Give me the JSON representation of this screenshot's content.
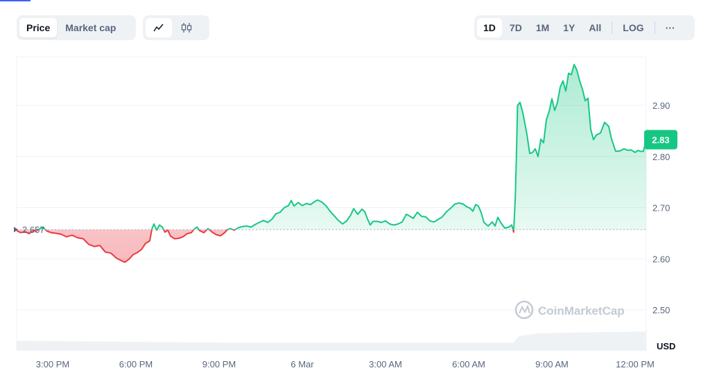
{
  "toggle": {
    "price_label": "Price",
    "market_cap_label": "Market cap"
  },
  "chart_type_icons": [
    "line-chart-icon",
    "candlestick-icon"
  ],
  "ranges": [
    "1D",
    "7D",
    "1M",
    "1Y",
    "All"
  ],
  "log_label": "LOG",
  "more_label": "···",
  "watermark": "CoinMarketCap",
  "colors": {
    "up": "#16c784",
    "down": "#ea3943",
    "grid": "#eff2f5",
    "axis_text": "#58667e"
  },
  "chart_data": {
    "type": "area",
    "baseline": 2.657,
    "baseline_label": "2.657",
    "current_value_label": "2.83",
    "current_value": 2.833,
    "y_unit": "USD",
    "y_ticks": [
      2.5,
      2.6,
      2.7,
      2.8,
      2.9
    ],
    "y_tick_labels": [
      "2.50",
      "2.60",
      "2.70",
      "2.80",
      "2.90"
    ],
    "ylim": [
      2.42,
      2.995
    ],
    "x_tick_labels": [
      "3:00 PM",
      "6:00 PM",
      "9:00 PM",
      "6 Mar",
      "3:00 AM",
      "6:00 AM",
      "9:00 AM",
      "12:00 PM"
    ],
    "x_tick_hours": [
      0,
      3,
      6,
      9,
      12,
      15,
      18,
      21
    ],
    "xlim_hours": [
      -1.3,
      21.4
    ],
    "series": [
      {
        "values": [
          [
            -1.3,
            2.655
          ],
          [
            -1.15,
            2.651
          ],
          [
            -1.0,
            2.653
          ],
          [
            -0.85,
            2.649
          ],
          [
            -0.7,
            2.655
          ],
          [
            -0.6,
            2.654
          ],
          [
            -0.5,
            2.658
          ],
          [
            -0.35,
            2.661
          ],
          [
            -0.2,
            2.654
          ],
          [
            -0.05,
            2.651
          ],
          [
            0.1,
            2.65
          ],
          [
            0.3,
            2.648
          ],
          [
            0.5,
            2.643
          ],
          [
            0.7,
            2.646
          ],
          [
            0.9,
            2.641
          ],
          [
            1.1,
            2.639
          ],
          [
            1.3,
            2.628
          ],
          [
            1.5,
            2.624
          ],
          [
            1.7,
            2.626
          ],
          [
            1.9,
            2.613
          ],
          [
            2.1,
            2.611
          ],
          [
            2.3,
            2.601
          ],
          [
            2.45,
            2.597
          ],
          [
            2.6,
            2.593
          ],
          [
            2.75,
            2.599
          ],
          [
            2.9,
            2.608
          ],
          [
            3.05,
            2.612
          ],
          [
            3.2,
            2.618
          ],
          [
            3.35,
            2.63
          ],
          [
            3.5,
            2.635
          ],
          [
            3.58,
            2.659
          ],
          [
            3.65,
            2.668
          ],
          [
            3.75,
            2.656
          ],
          [
            3.85,
            2.666
          ],
          [
            3.95,
            2.662
          ],
          [
            4.05,
            2.652
          ],
          [
            4.15,
            2.656
          ],
          [
            4.25,
            2.644
          ],
          [
            4.4,
            2.639
          ],
          [
            4.55,
            2.64
          ],
          [
            4.7,
            2.643
          ],
          [
            4.85,
            2.649
          ],
          [
            5.0,
            2.651
          ],
          [
            5.1,
            2.658
          ],
          [
            5.2,
            2.662
          ],
          [
            5.3,
            2.655
          ],
          [
            5.45,
            2.651
          ],
          [
            5.6,
            2.659
          ],
          [
            5.75,
            2.652
          ],
          [
            5.9,
            2.647
          ],
          [
            6.05,
            2.645
          ],
          [
            6.2,
            2.651
          ],
          [
            6.3,
            2.657
          ],
          [
            6.4,
            2.659
          ],
          [
            6.55,
            2.656
          ],
          [
            6.7,
            2.661
          ],
          [
            6.85,
            2.663
          ],
          [
            7.0,
            2.664
          ],
          [
            7.15,
            2.662
          ],
          [
            7.3,
            2.667
          ],
          [
            7.45,
            2.671
          ],
          [
            7.6,
            2.675
          ],
          [
            7.75,
            2.671
          ],
          [
            7.9,
            2.677
          ],
          [
            8.05,
            2.688
          ],
          [
            8.2,
            2.691
          ],
          [
            8.35,
            2.7
          ],
          [
            8.5,
            2.704
          ],
          [
            8.6,
            2.714
          ],
          [
            8.7,
            2.703
          ],
          [
            8.85,
            2.71
          ],
          [
            9.0,
            2.704
          ],
          [
            9.15,
            2.708
          ],
          [
            9.3,
            2.706
          ],
          [
            9.45,
            2.712
          ],
          [
            9.55,
            2.715
          ],
          [
            9.7,
            2.711
          ],
          [
            9.85,
            2.704
          ],
          [
            10.0,
            2.693
          ],
          [
            10.15,
            2.684
          ],
          [
            10.3,
            2.675
          ],
          [
            10.45,
            2.668
          ],
          [
            10.6,
            2.674
          ],
          [
            10.75,
            2.686
          ],
          [
            10.85,
            2.698
          ],
          [
            11.0,
            2.687
          ],
          [
            11.15,
            2.697
          ],
          [
            11.25,
            2.692
          ],
          [
            11.35,
            2.678
          ],
          [
            11.45,
            2.666
          ],
          [
            11.55,
            2.673
          ],
          [
            11.7,
            2.673
          ],
          [
            11.85,
            2.671
          ],
          [
            12.0,
            2.674
          ],
          [
            12.15,
            2.668
          ],
          [
            12.3,
            2.666
          ],
          [
            12.45,
            2.668
          ],
          [
            12.6,
            2.672
          ],
          [
            12.75,
            2.687
          ],
          [
            12.85,
            2.684
          ],
          [
            13.0,
            2.679
          ],
          [
            13.15,
            2.691
          ],
          [
            13.3,
            2.683
          ],
          [
            13.45,
            2.682
          ],
          [
            13.6,
            2.674
          ],
          [
            13.75,
            2.672
          ],
          [
            13.9,
            2.677
          ],
          [
            14.05,
            2.682
          ],
          [
            14.2,
            2.692
          ],
          [
            14.35,
            2.699
          ],
          [
            14.5,
            2.707
          ],
          [
            14.65,
            2.709
          ],
          [
            14.8,
            2.707
          ],
          [
            14.95,
            2.701
          ],
          [
            15.05,
            2.699
          ],
          [
            15.15,
            2.693
          ],
          [
            15.25,
            2.706
          ],
          [
            15.35,
            2.703
          ],
          [
            15.45,
            2.69
          ],
          [
            15.55,
            2.671
          ],
          [
            15.7,
            2.664
          ],
          [
            15.85,
            2.672
          ],
          [
            15.95,
            2.664
          ],
          [
            16.05,
            2.681
          ],
          [
            16.15,
            2.671
          ],
          [
            16.3,
            2.66
          ],
          [
            16.45,
            2.662
          ],
          [
            16.55,
            2.666
          ],
          [
            16.62,
            2.652
          ],
          [
            16.68,
            2.72
          ],
          [
            16.72,
            2.8
          ],
          [
            16.76,
            2.9
          ],
          [
            16.85,
            2.906
          ],
          [
            16.95,
            2.886
          ],
          [
            17.1,
            2.843
          ],
          [
            17.2,
            2.806
          ],
          [
            17.3,
            2.808
          ],
          [
            17.4,
            2.815
          ],
          [
            17.5,
            2.8
          ],
          [
            17.6,
            2.834
          ],
          [
            17.7,
            2.827
          ],
          [
            17.8,
            2.872
          ],
          [
            17.9,
            2.888
          ],
          [
            18.0,
            2.913
          ],
          [
            18.1,
            2.89
          ],
          [
            18.2,
            2.906
          ],
          [
            18.3,
            2.936
          ],
          [
            18.4,
            2.948
          ],
          [
            18.5,
            2.928
          ],
          [
            18.6,
            2.963
          ],
          [
            18.7,
            2.96
          ],
          [
            18.8,
            2.98
          ],
          [
            18.9,
            2.969
          ],
          [
            19.0,
            2.948
          ],
          [
            19.1,
            2.932
          ],
          [
            19.2,
            2.909
          ],
          [
            19.3,
            2.914
          ],
          [
            19.4,
            2.853
          ],
          [
            19.5,
            2.833
          ],
          [
            19.6,
            2.842
          ],
          [
            19.75,
            2.846
          ],
          [
            19.9,
            2.867
          ],
          [
            20.05,
            2.859
          ],
          [
            20.15,
            2.834
          ],
          [
            20.3,
            2.81
          ],
          [
            20.45,
            2.811
          ],
          [
            20.6,
            2.815
          ],
          [
            20.75,
            2.812
          ],
          [
            20.85,
            2.813
          ],
          [
            21.0,
            2.808
          ],
          [
            21.1,
            2.812
          ],
          [
            21.2,
            2.81
          ],
          [
            21.3,
            2.81
          ],
          [
            21.4,
            2.833
          ]
        ]
      }
    ],
    "volume_series": [
      [
        -1.3,
        0.055
      ],
      [
        2.0,
        0.05
      ],
      [
        6.0,
        0.045
      ],
      [
        10.0,
        0.045
      ],
      [
        14.0,
        0.045
      ],
      [
        16.62,
        0.045
      ],
      [
        16.8,
        0.08
      ],
      [
        17.5,
        0.095
      ],
      [
        19.0,
        0.1
      ],
      [
        21.4,
        0.105
      ]
    ]
  }
}
